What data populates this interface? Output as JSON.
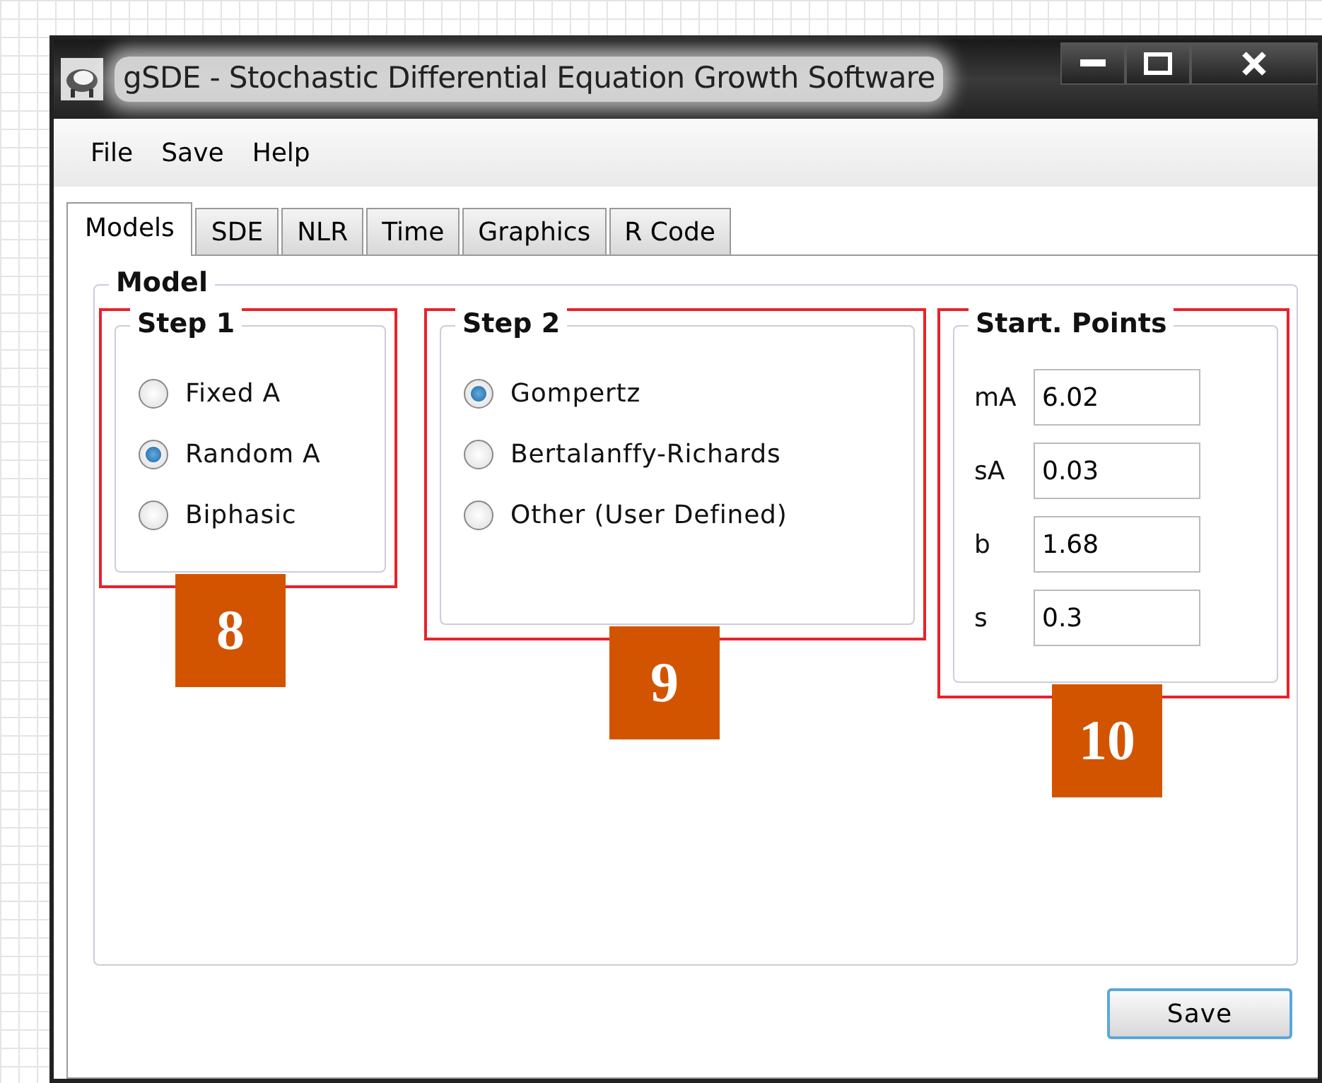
{
  "window": {
    "title": "gSDE - Stochastic Differential Equation Growth Software"
  },
  "menu": [
    "File",
    "Save",
    "Help"
  ],
  "tabs": [
    {
      "label": "Models",
      "selected": true
    },
    {
      "label": "SDE",
      "selected": false
    },
    {
      "label": "NLR",
      "selected": false
    },
    {
      "label": "Time",
      "selected": false
    },
    {
      "label": "Graphics",
      "selected": false
    },
    {
      "label": "R Code",
      "selected": false
    }
  ],
  "model": {
    "title": "Model",
    "groups": [
      {
        "title": "Step 1",
        "kind": "radios",
        "annotation": "8",
        "options": [
          {
            "label": "Fixed A",
            "selected": false
          },
          {
            "label": "Random A",
            "selected": true
          },
          {
            "label": "Biphasic",
            "selected": false
          }
        ]
      },
      {
        "title": "Step 2",
        "kind": "radios",
        "annotation": "9",
        "options": [
          {
            "label": "Gompertz",
            "selected": true
          },
          {
            "label": "Bertalanffy-Richards",
            "selected": false
          },
          {
            "label": "Other (User Defined)",
            "selected": false
          }
        ]
      },
      {
        "title": "Start. Points",
        "kind": "fields",
        "annotation": "10",
        "fields": [
          {
            "label": "mA",
            "value": "6.02"
          },
          {
            "label": "sA",
            "value": "0.03"
          },
          {
            "label": "b",
            "value": "1.68"
          },
          {
            "label": "s",
            "value": "0.3"
          }
        ]
      }
    ]
  },
  "buttons": [
    "Save"
  ]
}
